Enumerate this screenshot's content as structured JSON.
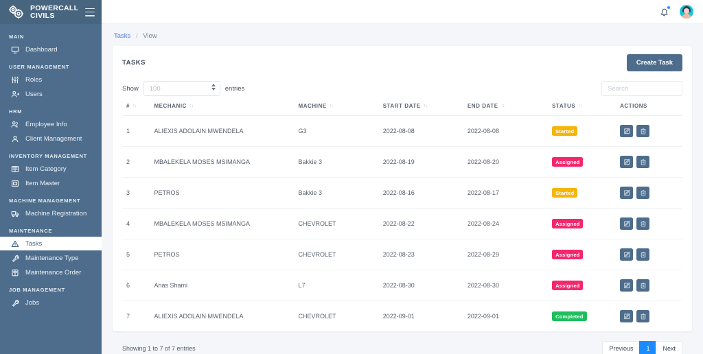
{
  "brand": {
    "line1": "POWERCALL",
    "line2": "CIVILS",
    "logo_icon": "gears-icon",
    "menu_icon": "hamburger-icon"
  },
  "topbar": {
    "bell_icon": "bell-icon",
    "avatar_icon": "user-avatar"
  },
  "sidebar": {
    "groups": [
      {
        "heading": "MAIN",
        "items": [
          {
            "label": "Dashboard",
            "icon": "dashboard-icon",
            "active": false
          }
        ]
      },
      {
        "heading": "USER MANAGEMENT",
        "items": [
          {
            "label": "Roles",
            "icon": "sliders-icon",
            "active": false
          },
          {
            "label": "Users",
            "icon": "user-plus-icon",
            "active": false
          }
        ]
      },
      {
        "heading": "HRM",
        "items": [
          {
            "label": "Employee Info",
            "icon": "users-icon",
            "active": false
          },
          {
            "label": "Client Management",
            "icon": "user-icon",
            "active": false
          }
        ]
      },
      {
        "heading": "INVENTORY MANAGEMENT",
        "items": [
          {
            "label": "Item Category",
            "icon": "book-icon",
            "active": false
          },
          {
            "label": "Item Master",
            "icon": "box-icon",
            "active": false
          }
        ]
      },
      {
        "heading": "MACHINE MANAGEMENT",
        "items": [
          {
            "label": "Machine Registration",
            "icon": "truck-icon",
            "active": false
          }
        ]
      },
      {
        "heading": "MAINTENANCE",
        "items": [
          {
            "label": "Tasks",
            "icon": "warning-triangle-icon",
            "active": true
          },
          {
            "label": "Maintenance Type",
            "icon": "wrench-icon",
            "active": false
          },
          {
            "label": "Maintenance Order",
            "icon": "clipboard-icon",
            "active": false
          }
        ]
      },
      {
        "heading": "JOB MANAGEMENT",
        "items": [
          {
            "label": "Jobs",
            "icon": "wrench-icon",
            "active": false
          }
        ]
      }
    ]
  },
  "breadcrumb": {
    "root": "Tasks",
    "separator": "/",
    "current": "View"
  },
  "card": {
    "title": "TASKS",
    "create_button": "Create Task"
  },
  "controls": {
    "show_label": "Show",
    "entries_label": "entries",
    "page_length_value": "100",
    "search_placeholder": "Search"
  },
  "table": {
    "columns": [
      {
        "label": "#",
        "sortable": true
      },
      {
        "label": "MECHANIC",
        "sortable": true
      },
      {
        "label": "MACHINE",
        "sortable": true
      },
      {
        "label": "START DATE",
        "sortable": true
      },
      {
        "label": "END DATE",
        "sortable": true
      },
      {
        "label": "STATUS",
        "sortable": true
      },
      {
        "label": "ACTIONS",
        "sortable": false
      }
    ],
    "rows": [
      {
        "num": "1",
        "mechanic": "ALIEXIS ADOLAIN MWENDELA",
        "machine": "G3",
        "start": "2022-08-08",
        "end": "2022-08-08",
        "status": "Started",
        "status_key": "started"
      },
      {
        "num": "2",
        "mechanic": "MBALEKELA MOSES MSIMANGA",
        "machine": "Bakkie 3",
        "start": "2022-08-19",
        "end": "2022-08-20",
        "status": "Assigned",
        "status_key": "assigned"
      },
      {
        "num": "3",
        "mechanic": "PETROS",
        "machine": "Bakkie 3",
        "start": "2022-08-16",
        "end": "2022-08-17",
        "status": "Started",
        "status_key": "started"
      },
      {
        "num": "4",
        "mechanic": "MBALEKELA MOSES MSIMANGA",
        "machine": "CHEVROLET",
        "start": "2022-08-22",
        "end": "2022-08-24",
        "status": "Assigned",
        "status_key": "assigned"
      },
      {
        "num": "5",
        "mechanic": "PETROS",
        "machine": "CHEVROLET",
        "start": "2022-08-23",
        "end": "2022-08-29",
        "status": "Assigned",
        "status_key": "assigned"
      },
      {
        "num": "6",
        "mechanic": "Anas Shami",
        "machine": "L7",
        "start": "2022-08-30",
        "end": "2022-08-30",
        "status": "Assigned",
        "status_key": "assigned"
      },
      {
        "num": "7",
        "mechanic": "ALIEXIS ADOLAIN MWENDELA",
        "machine": "CHEVROLET",
        "start": "2022-09-01",
        "end": "2022-09-01",
        "status": "Completed",
        "status_key": "completed"
      }
    ],
    "row_actions": [
      {
        "icon": "edit-icon",
        "label": "Edit"
      },
      {
        "icon": "trash-icon",
        "label": "Delete"
      }
    ]
  },
  "footer": {
    "entries_info": "Showing 1 to 7 of 7 entries",
    "pagination": {
      "previous": "Previous",
      "pages": [
        "1"
      ],
      "next": "Next",
      "current": "1"
    }
  },
  "colors": {
    "sidebar": "#4e6d8c",
    "accent_blue": "#1a8cff",
    "badge_started": "#f5b50a",
    "badge_assigned": "#f5276c",
    "badge_completed": "#1bbf5c",
    "breadcrumb_link": "#4b7bec"
  }
}
